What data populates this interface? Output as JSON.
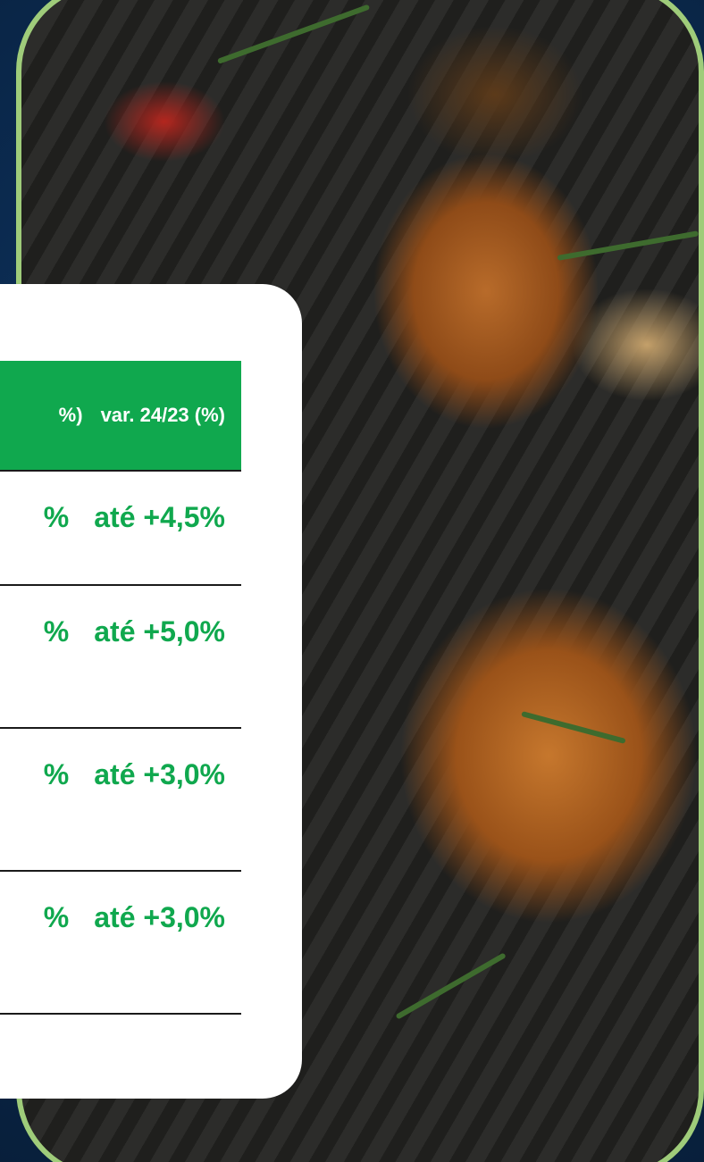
{
  "table": {
    "header": {
      "col_prev_fragment": "%)",
      "col_var": "var. 24/23 (%)"
    },
    "rows": [
      {
        "prev_fragment": "%",
        "var": "até +4,5%"
      },
      {
        "prev_fragment": "%",
        "var": "até +5,0%"
      },
      {
        "prev_fragment": "%",
        "var": "até +3,0%"
      },
      {
        "prev_fragment": "%",
        "var": "até +3,0%"
      }
    ]
  },
  "colors": {
    "accent_green": "#10a84e",
    "frame_green": "#9fcc7a",
    "background_navy": "#0b2a4f"
  }
}
